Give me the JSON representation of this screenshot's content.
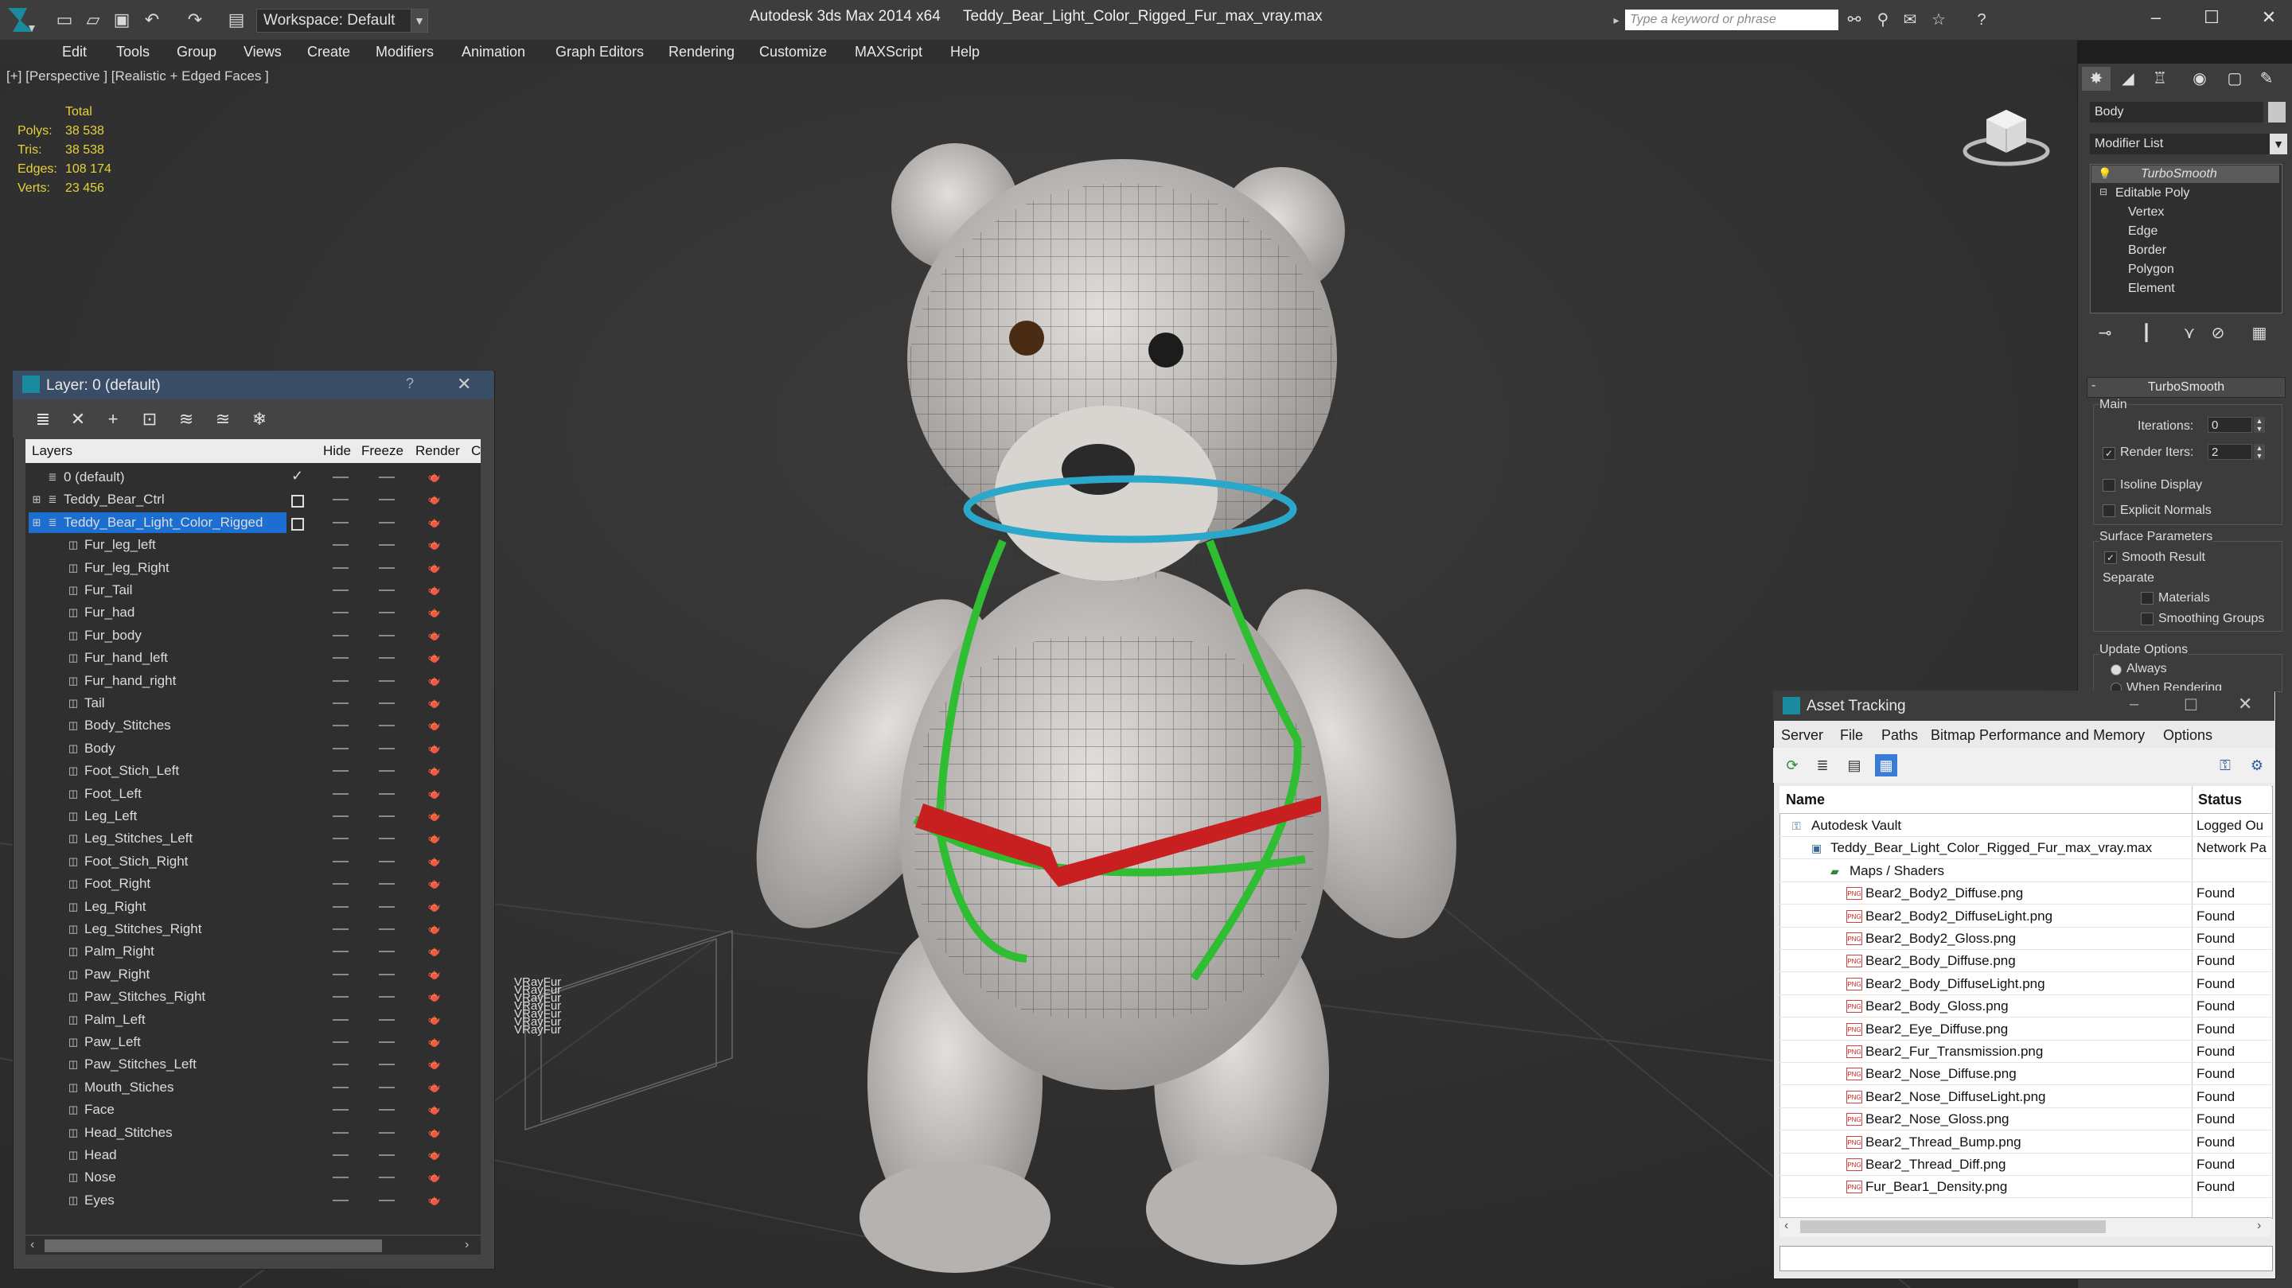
{
  "titlebar": {
    "workspace": "Workspace: Default",
    "app_title": "Autodesk 3ds Max  2014 x64",
    "file_title": "Teddy_Bear_Light_Color_Rigged_Fur_max_vray.max",
    "search_placeholder": "Type a keyword or phrase",
    "help_icon": "?"
  },
  "menu": [
    "Edit",
    "Tools",
    "Group",
    "Views",
    "Create",
    "Modifiers",
    "Animation",
    "Graph Editors",
    "Rendering",
    "Customize",
    "MAXScript",
    "Help"
  ],
  "viewport": {
    "label": "[+] [Perspective ] [Realistic + Edged Faces ]",
    "stats": {
      "header": "Total",
      "rows": [
        {
          "label": "Polys:",
          "value": "38 538"
        },
        {
          "label": "Tris:",
          "value": "38 538"
        },
        {
          "label": "Edges:",
          "value": "108 174"
        },
        {
          "label": "Verts:",
          "value": "23 456"
        }
      ]
    },
    "vrayfur_labels": [
      "VRayFur",
      "VRayFur",
      "VRayFur",
      "VRayFur",
      "VRayFur",
      "VRayFur",
      "VRayFur"
    ]
  },
  "command_panel": {
    "object_name": "Body",
    "modifier_list": "Modifier List",
    "stack": [
      "TurboSmooth",
      "Editable Poly",
      "Vertex",
      "Edge",
      "Border",
      "Polygon",
      "Element"
    ],
    "rollout_title": "TurboSmooth",
    "main_label": "Main",
    "iterations_label": "Iterations:",
    "iterations_value": "0",
    "render_iters_label": "Render Iters:",
    "render_iters_value": "2",
    "isoline": "Isoline Display",
    "explicit_normals": "Explicit Normals",
    "surface_params": "Surface Parameters",
    "smooth_result": "Smooth Result",
    "separate": "Separate",
    "materials": "Materials",
    "smoothing_groups": "Smoothing Groups",
    "update_options": "Update Options",
    "always": "Always",
    "when_rendering": "When Rendering"
  },
  "layer_dialog": {
    "title": "Layer: 0 (default)",
    "help": "?",
    "columns": [
      "Layers",
      "Hide",
      "Freeze",
      "Render",
      "C"
    ],
    "layers": [
      {
        "name": "0 (default)",
        "kind": "layer"
      },
      {
        "name": "Teddy_Bear_Ctrl",
        "kind": "layer"
      },
      {
        "name": "Teddy_Bear_Light_Color_Rigged",
        "kind": "layer"
      },
      {
        "name": "Fur_leg_left",
        "kind": "object"
      },
      {
        "name": "Fur_leg_Right",
        "kind": "object"
      },
      {
        "name": "Fur_Tail",
        "kind": "object"
      },
      {
        "name": "Fur_had",
        "kind": "object"
      },
      {
        "name": "Fur_body",
        "kind": "object"
      },
      {
        "name": "Fur_hand_left",
        "kind": "object"
      },
      {
        "name": "Fur_hand_right",
        "kind": "object"
      },
      {
        "name": "Tail",
        "kind": "object"
      },
      {
        "name": "Body_Stitches",
        "kind": "object"
      },
      {
        "name": "Body",
        "kind": "object"
      },
      {
        "name": "Foot_Stich_Left",
        "kind": "object"
      },
      {
        "name": "Foot_Left",
        "kind": "object"
      },
      {
        "name": "Leg_Left",
        "kind": "object"
      },
      {
        "name": "Leg_Stitches_Left",
        "kind": "object"
      },
      {
        "name": "Foot_Stich_Right",
        "kind": "object"
      },
      {
        "name": "Foot_Right",
        "kind": "object"
      },
      {
        "name": "Leg_Right",
        "kind": "object"
      },
      {
        "name": "Leg_Stitches_Right",
        "kind": "object"
      },
      {
        "name": "Palm_Right",
        "kind": "object"
      },
      {
        "name": "Paw_Right",
        "kind": "object"
      },
      {
        "name": "Paw_Stitches_Right",
        "kind": "object"
      },
      {
        "name": "Palm_Left",
        "kind": "object"
      },
      {
        "name": "Paw_Left",
        "kind": "object"
      },
      {
        "name": "Paw_Stitches_Left",
        "kind": "object"
      },
      {
        "name": "Mouth_Stiches",
        "kind": "object"
      },
      {
        "name": "Face",
        "kind": "object"
      },
      {
        "name": "Head_Stitches",
        "kind": "object"
      },
      {
        "name": "Head",
        "kind": "object"
      },
      {
        "name": "Nose",
        "kind": "object"
      },
      {
        "name": "Eyes",
        "kind": "object"
      }
    ],
    "selected_layer": "Teddy_Bear_Light_Color_Rigged"
  },
  "asset_tracking": {
    "title": "Asset Tracking",
    "menu": [
      "Server",
      "File",
      "Paths",
      "Bitmap Performance and Memory",
      "Options"
    ],
    "columns": [
      "Name",
      "Status"
    ],
    "rows": [
      {
        "name": "Autodesk Vault",
        "status": "Logged Ou",
        "icon": "vault-icon"
      },
      {
        "name": "Teddy_Bear_Light_Color_Rigged_Fur_max_vray.max",
        "status": "Network Pa",
        "icon": "max-file-icon"
      },
      {
        "name": "Maps / Shaders",
        "status": "",
        "icon": "maps-icon"
      },
      {
        "name": "Bear2_Body2_Diffuse.png",
        "status": "Found",
        "icon": "png-icon"
      },
      {
        "name": "Bear2_Body2_DiffuseLight.png",
        "status": "Found",
        "icon": "png-icon"
      },
      {
        "name": "Bear2_Body2_Gloss.png",
        "status": "Found",
        "icon": "png-icon"
      },
      {
        "name": "Bear2_Body_Diffuse.png",
        "status": "Found",
        "icon": "png-icon"
      },
      {
        "name": "Bear2_Body_DiffuseLight.png",
        "status": "Found",
        "icon": "png-icon"
      },
      {
        "name": "Bear2_Body_Gloss.png",
        "status": "Found",
        "icon": "png-icon"
      },
      {
        "name": "Bear2_Eye_Diffuse.png",
        "status": "Found",
        "icon": "png-icon"
      },
      {
        "name": "Bear2_Fur_Transmission.png",
        "status": "Found",
        "icon": "png-icon"
      },
      {
        "name": "Bear2_Nose_Diffuse.png",
        "status": "Found",
        "icon": "png-icon"
      },
      {
        "name": "Bear2_Nose_DiffuseLight.png",
        "status": "Found",
        "icon": "png-icon"
      },
      {
        "name": "Bear2_Nose_Gloss.png",
        "status": "Found",
        "icon": "png-icon"
      },
      {
        "name": "Bear2_Thread_Bump.png",
        "status": "Found",
        "icon": "png-icon"
      },
      {
        "name": "Bear2_Thread_Diff.png",
        "status": "Found",
        "icon": "png-icon"
      },
      {
        "name": "Fur_Bear1_Density.png",
        "status": "Found",
        "icon": "png-icon"
      }
    ]
  },
  "colors": {
    "stats_yellow": "#e6d23a",
    "selection_blue": "#1c6fd1",
    "bear_fur": "#c9c6c2",
    "ctrl_cyan": "#2aa7c9",
    "ctrl_green": "#2fbe32",
    "ctrl_red": "#c82020"
  }
}
